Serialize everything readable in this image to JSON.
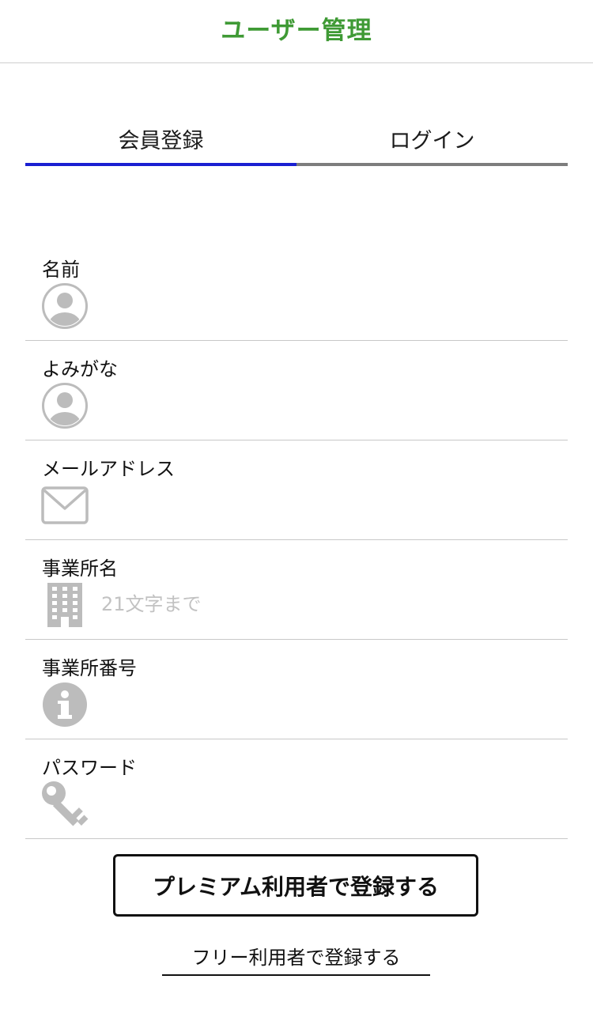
{
  "header": {
    "title": "ユーザー管理",
    "title_color": "#3f9a35"
  },
  "tabs": [
    {
      "label": "会員登録",
      "active": true,
      "indicator_color": "#1a1fd1"
    },
    {
      "label": "ログイン",
      "active": false,
      "indicator_color": "#7d7d7d"
    }
  ],
  "form": {
    "fields": [
      {
        "label": "名前",
        "icon": "person-icon",
        "value": "",
        "placeholder": ""
      },
      {
        "label": "よみがな",
        "icon": "person-icon",
        "value": "",
        "placeholder": ""
      },
      {
        "label": "メールアドレス",
        "icon": "envelope-icon",
        "value": "",
        "placeholder": ""
      },
      {
        "label": "事業所名",
        "icon": "building-icon",
        "value": "",
        "placeholder": "21文字まで"
      },
      {
        "label": "事業所番号",
        "icon": "info-icon",
        "value": "",
        "placeholder": ""
      },
      {
        "label": "パスワード",
        "icon": "key-icon",
        "value": "",
        "placeholder": ""
      }
    ]
  },
  "actions": {
    "premium_label": "プレミアム利用者で登録する",
    "free_label": "フリー利用者で登録する"
  },
  "colors": {
    "icon_gray": "#bcbcbc",
    "divider": "#c8c8c8"
  }
}
